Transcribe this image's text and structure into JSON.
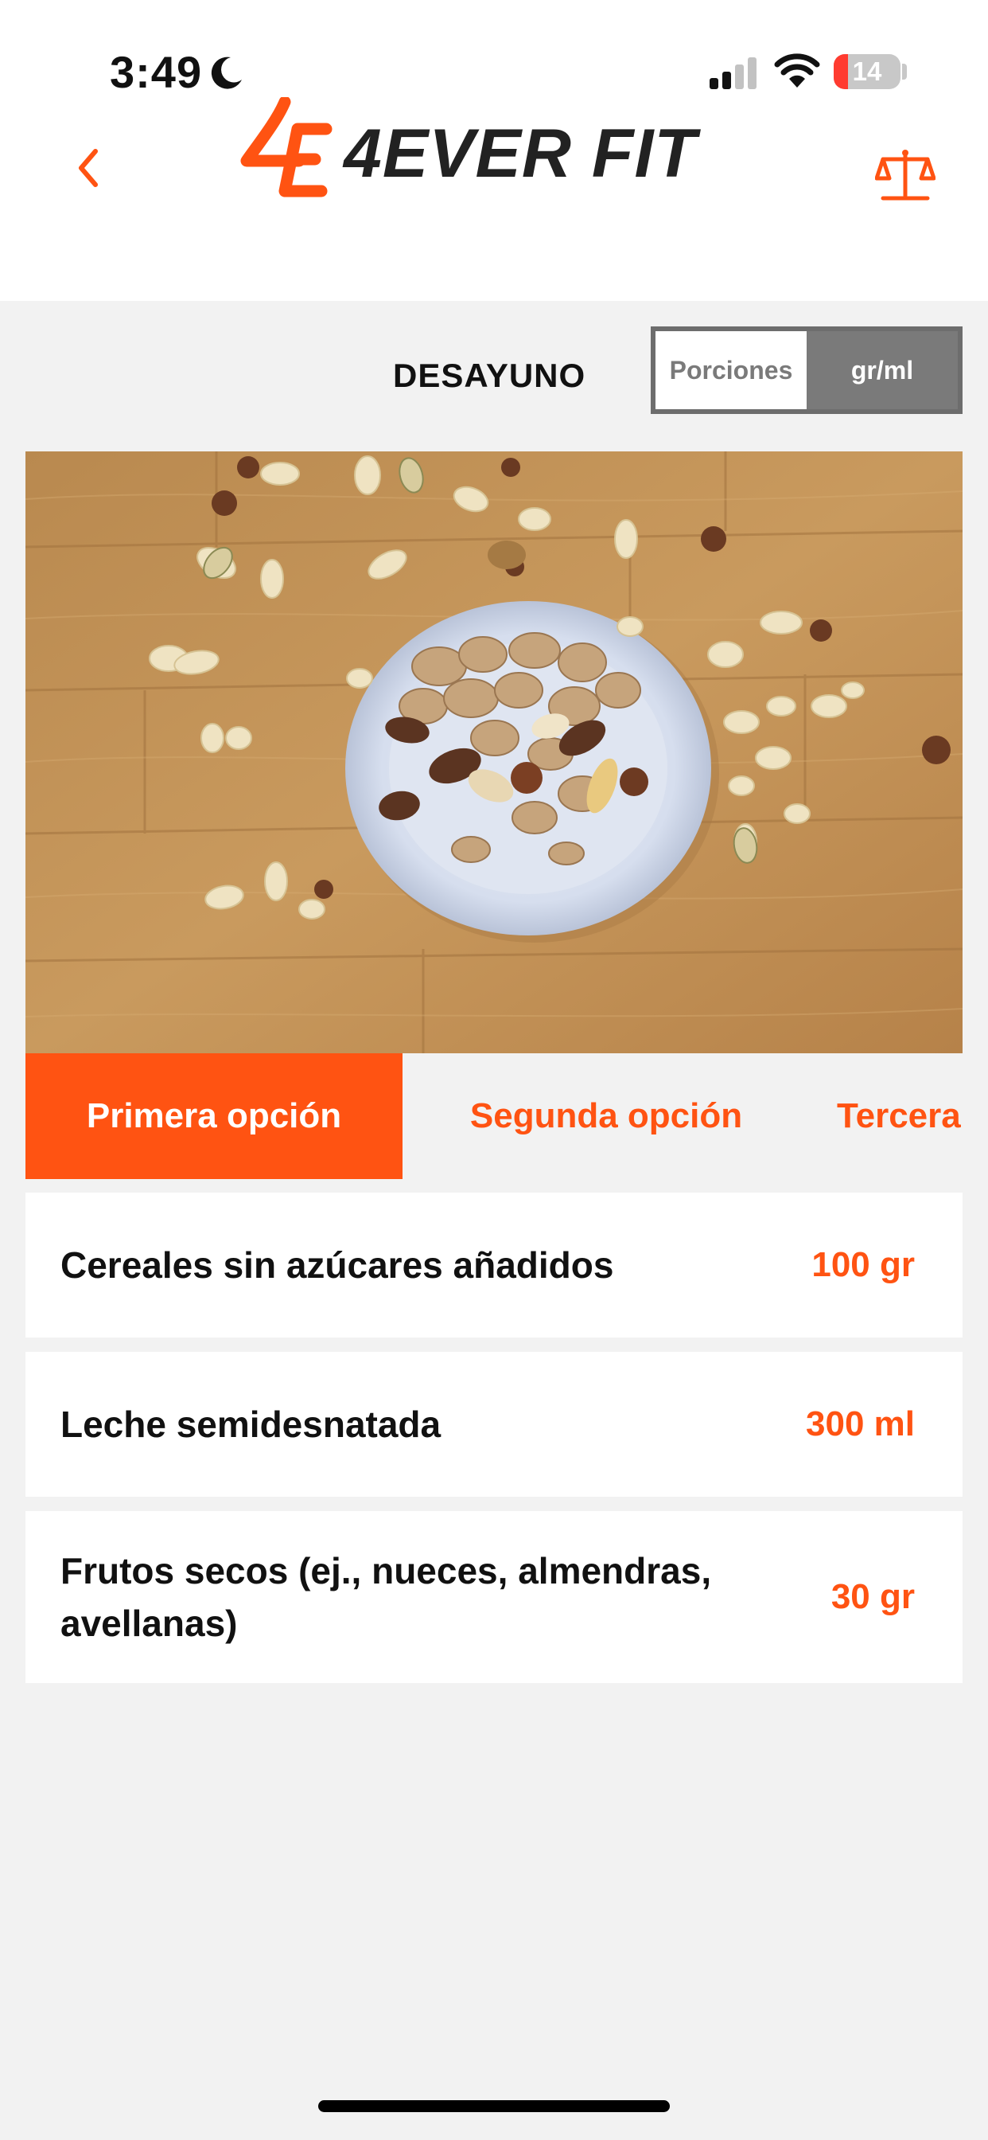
{
  "status_bar": {
    "time": "3:49",
    "battery_level": "14"
  },
  "header": {
    "logo_mark": "4E",
    "logo_text": "4EVER FIT"
  },
  "meal": {
    "title": "DESAYUNO"
  },
  "toggle": {
    "option_a": "Porciones",
    "option_b": "gr/ml",
    "selected": "gr/ml"
  },
  "tabs": [
    {
      "label": "Primera opción",
      "active": true
    },
    {
      "label": "Segunda opción",
      "active": false
    },
    {
      "label": "Tercera opción",
      "active": false
    }
  ],
  "ingredients": [
    {
      "name": "Cereales sin azúcares añadidos",
      "qty": "100 gr"
    },
    {
      "name": "Leche semidesnatada",
      "qty": "300 ml"
    },
    {
      "name": "Frutos secos (ej., nueces, almendras, avellanas)",
      "qty": "30 gr"
    }
  ],
  "colors": {
    "accent": "#ff5312",
    "toggle_gray": "#7a7a7a",
    "background": "#f2f2f2"
  },
  "icons": [
    "moon-icon",
    "signal-icon",
    "wifi-icon",
    "battery-icon",
    "back-chevron-icon",
    "scale-icon"
  ]
}
